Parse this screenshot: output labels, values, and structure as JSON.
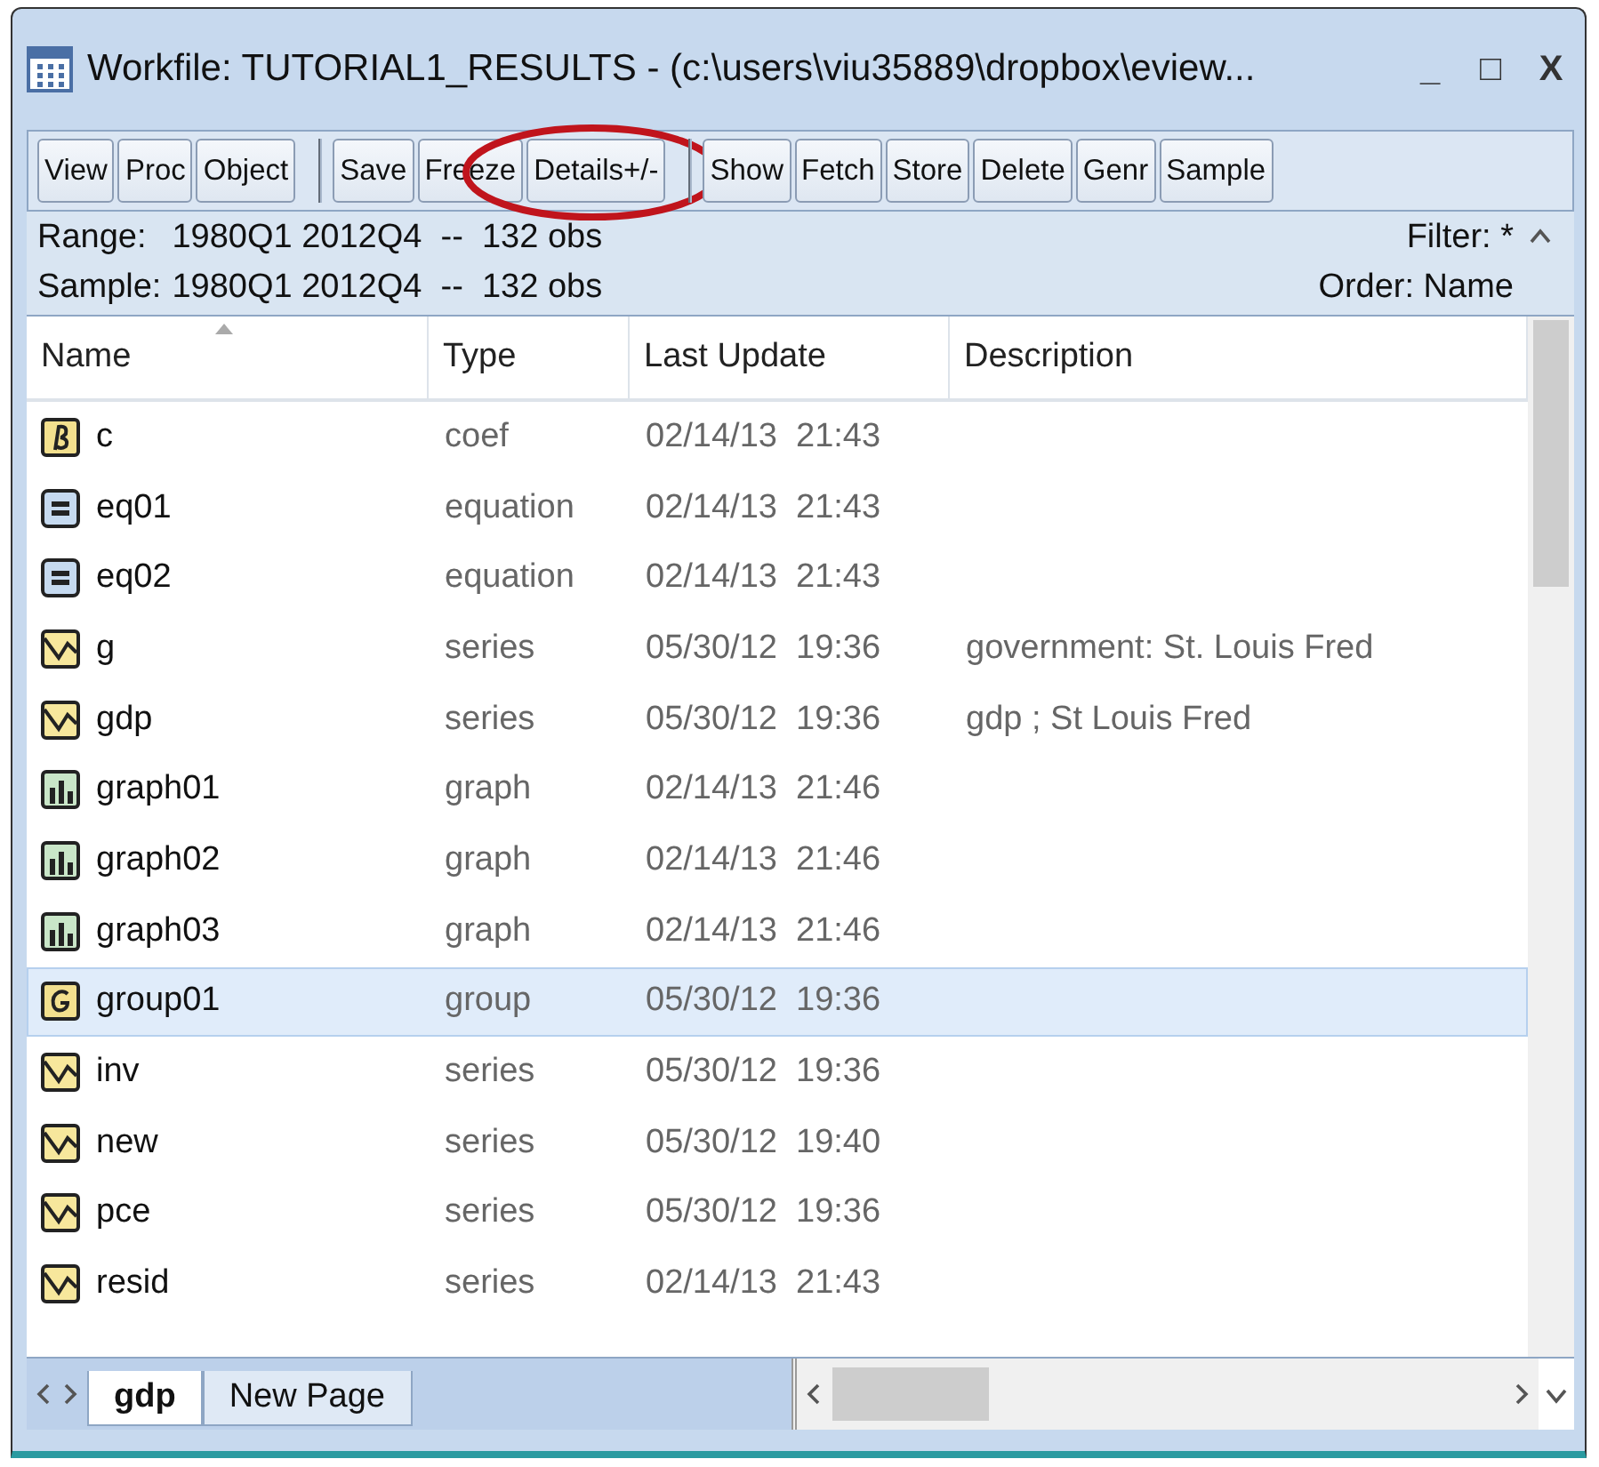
{
  "window": {
    "title": "Workfile: TUTORIAL1_RESULTS - (c:\\users\\viu35889\\dropbox\\eview...",
    "controls": [
      "_",
      "□",
      "X"
    ]
  },
  "toolbar": [
    {
      "label": "View",
      "group_start": false
    },
    {
      "label": "Proc",
      "group_start": false
    },
    {
      "label": "Object",
      "group_start": false
    },
    {
      "label": "Save",
      "group_start": true
    },
    {
      "label": "Freeze",
      "group_start": false
    },
    {
      "label": "Details+/-",
      "group_start": false,
      "circled": true
    },
    {
      "label": "Show",
      "group_start": true
    },
    {
      "label": "Fetch",
      "group_start": false
    },
    {
      "label": "Store",
      "group_start": false
    },
    {
      "label": "Delete",
      "group_start": false
    },
    {
      "label": "Genr",
      "group_start": false
    },
    {
      "label": "Sample",
      "group_start": false
    }
  ],
  "info": {
    "range_label": "Range:",
    "range": "1980Q1 2012Q4  --  132 obs",
    "sample_label": "Sample:",
    "sample": "1980Q1 2012Q4  --  132 obs",
    "filter": "Filter: *",
    "order": "Order: Name"
  },
  "table": {
    "columns": [
      "Name",
      "Type",
      "Last Update",
      "Description"
    ],
    "rows": [
      {
        "kind": "coef",
        "name": "c",
        "type": "coef",
        "updated": "02/14/13  21:43",
        "description": "",
        "selected": false
      },
      {
        "kind": "equation",
        "name": "eq01",
        "type": "equation",
        "updated": "02/14/13  21:43",
        "description": "",
        "selected": false
      },
      {
        "kind": "equation",
        "name": "eq02",
        "type": "equation",
        "updated": "02/14/13  21:43",
        "description": "",
        "selected": false
      },
      {
        "kind": "series",
        "name": "g",
        "type": "series",
        "updated": "05/30/12  19:36",
        "description": "government: St. Louis Fred",
        "selected": false
      },
      {
        "kind": "series",
        "name": "gdp",
        "type": "series",
        "updated": "05/30/12  19:36",
        "description": "gdp ; St Louis Fred",
        "selected": false
      },
      {
        "kind": "graph",
        "name": "graph01",
        "type": "graph",
        "updated": "02/14/13  21:46",
        "description": "",
        "selected": false
      },
      {
        "kind": "graph",
        "name": "graph02",
        "type": "graph",
        "updated": "02/14/13  21:46",
        "description": "",
        "selected": false
      },
      {
        "kind": "graph",
        "name": "graph03",
        "type": "graph",
        "updated": "02/14/13  21:46",
        "description": "",
        "selected": false
      },
      {
        "kind": "group",
        "name": "group01",
        "type": "group",
        "updated": "05/30/12  19:36",
        "description": "",
        "selected": true
      },
      {
        "kind": "series",
        "name": "inv",
        "type": "series",
        "updated": "05/30/12  19:36",
        "description": "",
        "selected": false
      },
      {
        "kind": "series",
        "name": "new",
        "type": "series",
        "updated": "05/30/12  19:40",
        "description": "",
        "selected": false
      },
      {
        "kind": "series",
        "name": "pce",
        "type": "series",
        "updated": "05/30/12  19:36",
        "description": "",
        "selected": false
      },
      {
        "kind": "series",
        "name": "resid",
        "type": "series",
        "updated": "02/14/13  21:43",
        "description": "",
        "selected": false
      }
    ]
  },
  "page_tabs": [
    {
      "label": "gdp",
      "selected": true
    },
    {
      "label": "New Page",
      "selected": false
    }
  ]
}
